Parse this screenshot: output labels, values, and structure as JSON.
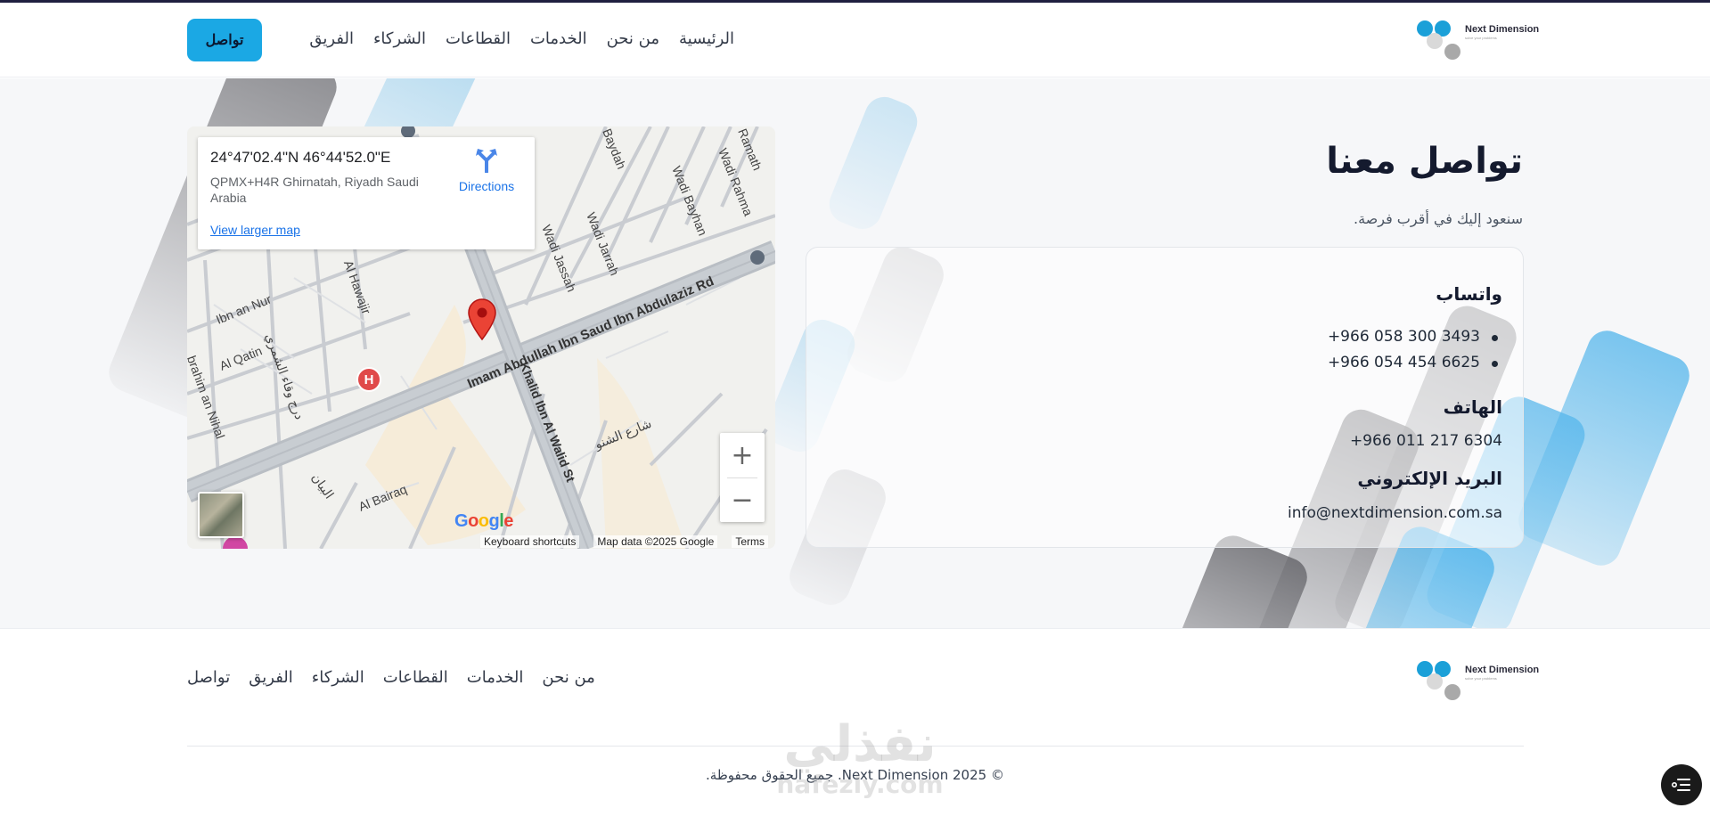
{
  "header": {
    "logo": {
      "name": "Next Dimension",
      "tagline": "solve your problems"
    },
    "nav": [
      {
        "key": "home",
        "label": "الرئيسية"
      },
      {
        "key": "about",
        "label": "من نحن"
      },
      {
        "key": "services",
        "label": "الخدمات"
      },
      {
        "key": "sectors",
        "label": "القطاعات"
      },
      {
        "key": "partners",
        "label": "الشركاء"
      },
      {
        "key": "team",
        "label": "الفريق"
      }
    ],
    "cta_label": "تواصل"
  },
  "map": {
    "coords": "24°47'02.4\"N 46°44'52.0\"E",
    "address": "QPMX+H4R Ghirnatah, Riyadh Saudi Arabia",
    "directions_label": "Directions",
    "view_larger": "View larger map",
    "streets": [
      "Imam Abdullah Ibn Saud Ibn Abdulaziz Rd",
      "Khalid Ibn Al Walid St",
      "Wadi Jassah",
      "Wadi Jarrah",
      "Wadi Bayhan",
      "Wadi Rahma",
      "Ramath",
      "Baydah",
      "Al Hawajir",
      "Ibn an Nur",
      "Al Qatin",
      "brahim an Nihal",
      "Al Bairaq",
      "درج وقاء الشمري",
      "شارع الشنو",
      "البيان"
    ],
    "google_letters": [
      "G",
      "o",
      "o",
      "g",
      "l",
      "e"
    ],
    "attribution": [
      "Keyboard shortcuts",
      "Map data ©2025 Google",
      "Terms"
    ],
    "zoom_in": "+",
    "zoom_out": "−",
    "hospital_marker": "H"
  },
  "contact": {
    "title": "تواصل معنا",
    "subtitle": "سنعود إليك في أقرب فرصة.",
    "whatsapp_heading": "واتساب",
    "whatsapp_numbers": [
      "+966 058 300 3493",
      "+966 054 454 6625"
    ],
    "phone_heading": "الهاتف",
    "phone": "+966 011 217 6304",
    "email_heading": "البريد الإلكتروني",
    "email": "info@nextdimension.com.sa"
  },
  "footer": {
    "logo": {
      "name": "Next Dimension",
      "tagline": "solve your problems"
    },
    "nav": [
      {
        "key": "about",
        "label": "من نحن"
      },
      {
        "key": "services",
        "label": "الخدمات"
      },
      {
        "key": "sectors",
        "label": "القطاعات"
      },
      {
        "key": "partners",
        "label": "الشركاء"
      },
      {
        "key": "team",
        "label": "الفريق"
      },
      {
        "key": "contact",
        "label": "تواصل"
      }
    ],
    "copyright": "© 2025 Next Dimension. جميع الحقوق محفوظة.",
    "watermark_ar": "نفذلي",
    "watermark_url": "nafezly.com"
  },
  "colors": {
    "accent": "#1ba8e4",
    "dark": "#141a2e",
    "logo_blue": "#1ba0d8",
    "logo_gray": "#a9a9a9",
    "map_pin": "#ea4335",
    "link": "#1a73e8"
  },
  "icons": {
    "directions": "directions-icon",
    "pin": "map-pin-icon",
    "hospital": "hospital-marker-icon",
    "menu_fab": "menu-lines-icon"
  }
}
